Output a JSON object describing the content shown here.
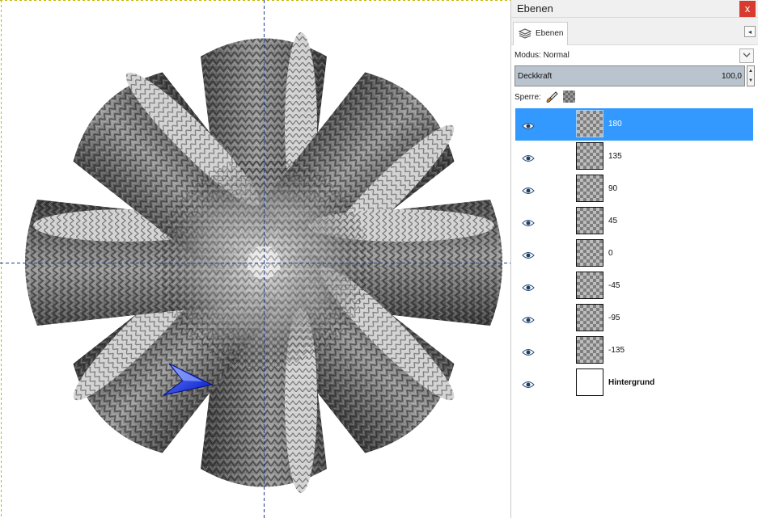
{
  "panel": {
    "title": "Ebenen",
    "close_glyph": "x",
    "tab_label": "Ebenen",
    "menu_glyph": "◂",
    "mode_label": "Modus:",
    "mode_value": "Normal",
    "opacity_label": "Deckkraft",
    "opacity_value": "100,0",
    "lock_label": "Sperre:",
    "lock_icons": [
      "paintbrush-icon",
      "alpha-checker-icon"
    ]
  },
  "layers": [
    {
      "name": "180",
      "selected": true,
      "visible": true
    },
    {
      "name": "135",
      "selected": false,
      "visible": true
    },
    {
      "name": "90",
      "selected": false,
      "visible": true
    },
    {
      "name": "45",
      "selected": false,
      "visible": true
    },
    {
      "name": "0",
      "selected": false,
      "visible": true
    },
    {
      "name": "-45",
      "selected": false,
      "visible": true
    },
    {
      "name": "-95",
      "selected": false,
      "visible": true
    },
    {
      "name": "-135",
      "selected": false,
      "visible": true
    },
    {
      "name": "Hintergrund",
      "selected": false,
      "visible": true,
      "bold": true,
      "thumbnail": "white"
    }
  ],
  "colors": {
    "selection": "#3399ff",
    "guide": "#1a3d8f",
    "close": "#d93a2f",
    "pointer": "#0a2cff"
  },
  "icons": {
    "visibility": "eye-icon",
    "tab": "layers-icon",
    "pointer": "arrow-pointer-icon"
  }
}
